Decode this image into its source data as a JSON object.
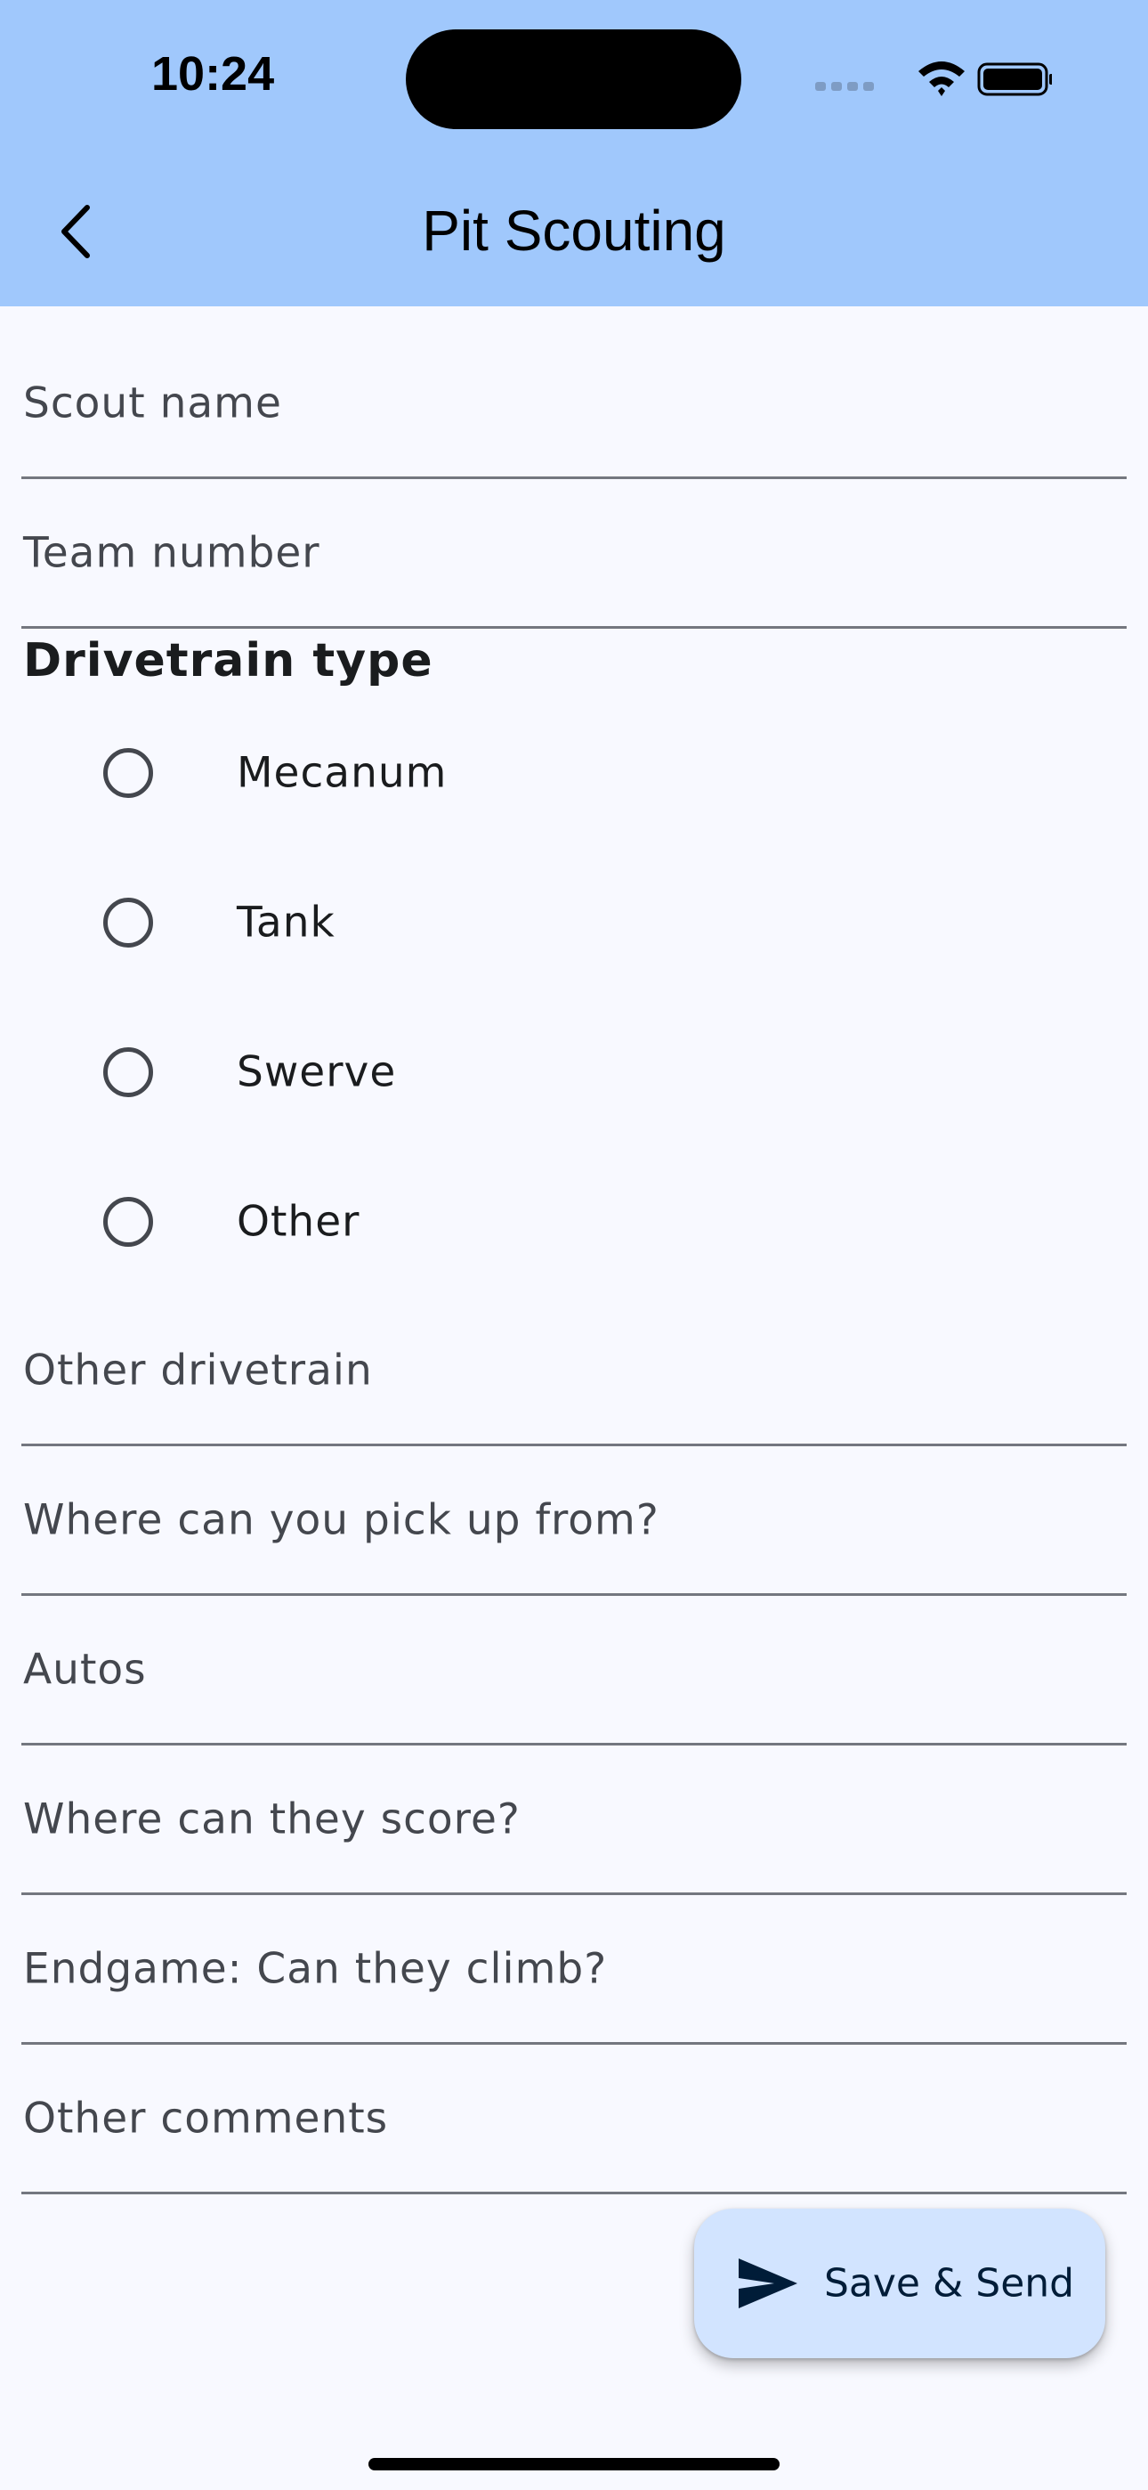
{
  "status_bar": {
    "time": "10:24"
  },
  "app_bar": {
    "title": "Pit Scouting",
    "back_icon": "chevron-left-icon"
  },
  "form": {
    "scout_name": {
      "placeholder": "Scout name",
      "value": ""
    },
    "team_number": {
      "placeholder": "Team number",
      "value": ""
    },
    "drivetrain_heading": "Drivetrain type",
    "drivetrain_options": [
      {
        "label": "Mecanum",
        "selected": false
      },
      {
        "label": "Tank",
        "selected": false
      },
      {
        "label": "Swerve",
        "selected": false
      },
      {
        "label": "Other",
        "selected": false
      }
    ],
    "other_drivetrain": {
      "placeholder": "Other drivetrain",
      "value": ""
    },
    "pickup": {
      "placeholder": "Where can you pick up from?",
      "value": ""
    },
    "autos": {
      "placeholder": "Autos",
      "value": ""
    },
    "score": {
      "placeholder": "Where can they score?",
      "value": ""
    },
    "endgame": {
      "placeholder": "Endgame: Can they climb?",
      "value": ""
    },
    "comments": {
      "placeholder": "Other comments",
      "value": ""
    }
  },
  "fab": {
    "label": "Save & Send",
    "icon": "send-icon"
  },
  "colors": {
    "app_bar": "#a0c8fc",
    "background": "#f8f9ff",
    "fab": "#d2e4ff"
  }
}
